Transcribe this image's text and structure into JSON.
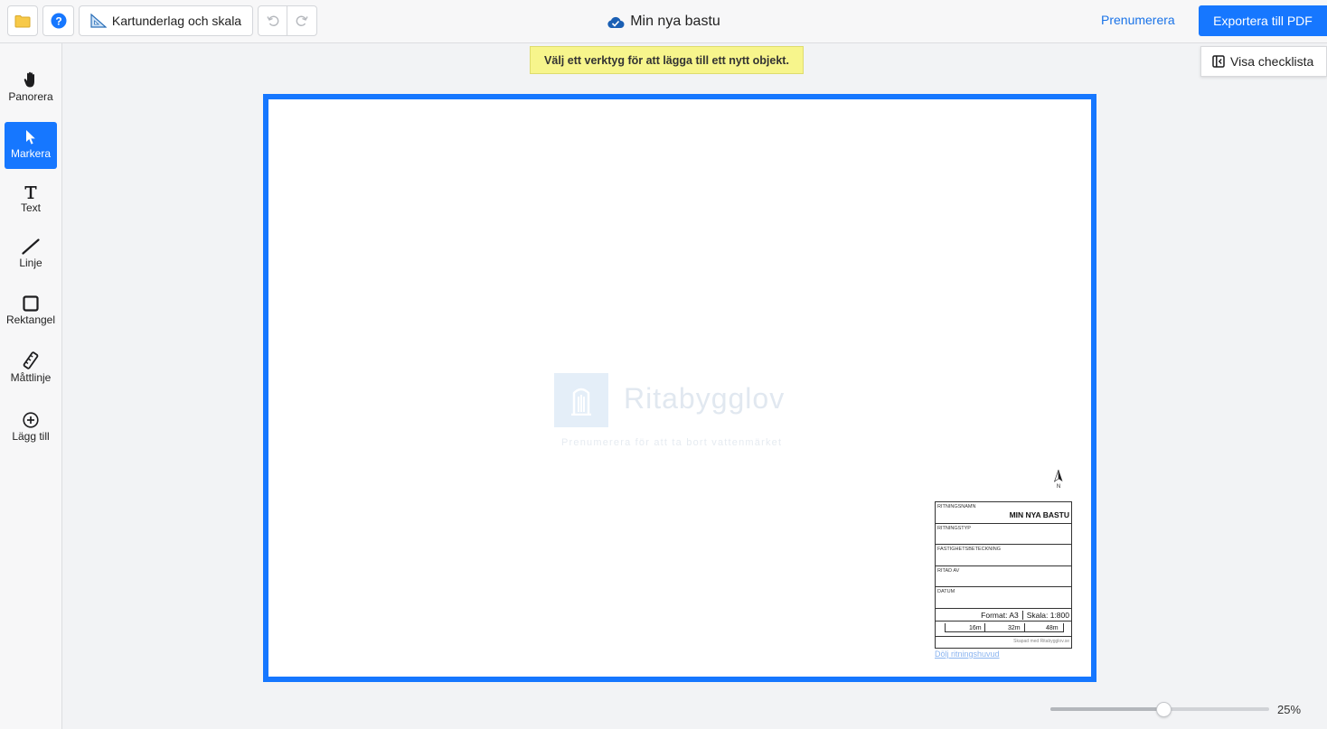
{
  "header": {
    "map_button_label": "Kartunderlag och skala",
    "document_title": "Min nya bastu",
    "subscribe_label": "Prenumerera",
    "export_label": "Exportera till PDF"
  },
  "sidebar": {
    "tools": [
      {
        "label": "Panorera",
        "icon": "hand-icon"
      },
      {
        "label": "Markera",
        "icon": "pointer-icon"
      },
      {
        "label": "Text",
        "icon": "text-icon"
      },
      {
        "label": "Linje",
        "icon": "line-icon"
      },
      {
        "label": "Rektangel",
        "icon": "rectangle-icon"
      },
      {
        "label": "Måttlinje",
        "icon": "ruler-icon"
      },
      {
        "label": "Lägg till",
        "icon": "add-icon"
      }
    ],
    "active_tool": "Markera"
  },
  "canvas": {
    "hint": "Välj ett verktyg för att lägga till ett nytt objekt.",
    "checklist_label": "Visa checklista",
    "watermark": {
      "name": "Ritabygglov",
      "subtitle": "Prenumerera för att ta bort vattenmärket"
    },
    "north_label": "N",
    "title_block": {
      "drawing_name_caption": "RITNINGSNAMN",
      "drawing_name": "MIN NYA BASTU",
      "drawing_type_caption": "RITNINGSTYP",
      "property_caption": "FASTIGHETSBETECKNING",
      "drawn_by_caption": "RITAD AV",
      "date_caption": "DATUM",
      "format_text": "Format: A3",
      "scale_text": "Skala: 1:800",
      "scale_labels": [
        "16m",
        "32m",
        "48m"
      ],
      "credit": "Skapad med Ritabygglov.se"
    },
    "hide_title_block_link": "Dölj ritningshuvud"
  },
  "zoom": {
    "value": "25%",
    "fraction": 0.5
  },
  "colors": {
    "accent": "#1677ff",
    "hint_background": "#f7f58c",
    "link": "#1a73e8"
  }
}
